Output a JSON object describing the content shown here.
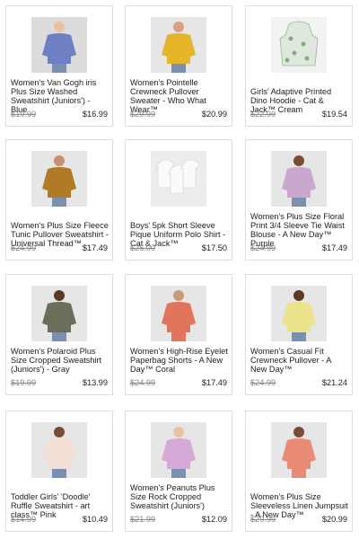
{
  "products": [
    {
      "title": "Women's Van Gogh iris Plus Size Washed Sweatshirt (Juniors') - Blue",
      "old_price": "$19.99",
      "price": "$16.99",
      "image": "van-gogh-sweatshirt",
      "color": "#6f7fc4",
      "skin": "#e8c3a3",
      "bg": "#dcdcdc"
    },
    {
      "title": "Women's Pointelle Crewneck Pullover Sweater - Who What Wear™",
      "old_price": "$29.99",
      "price": "$20.99",
      "image": "yellow-sweater",
      "color": "#e6b52a",
      "skin": "#d9a27e",
      "bg": "#e6e6e6"
    },
    {
      "title": "Girls' Adaptive Printed Dino Hoodie - Cat & Jack™ Cream",
      "old_price": "$22.99",
      "price": "$19.54",
      "image": "dino-hoodie",
      "color": "#dfe8dc",
      "skin": "#ffffff",
      "bg": "#f3f3f3"
    },
    {
      "title": "Women's Plus Size Fleece Tunic Pullover Sweatshirt - Universal Thread™",
      "old_price": "$24.99",
      "price": "$17.49",
      "image": "brown-sweatshirt",
      "color": "#b07a27",
      "skin": "#c99070",
      "bg": "#e6e6e6"
    },
    {
      "title": "Boys' 5pk Short Sleeve Pique Uniform Polo Shirt - Cat & Jack™",
      "old_price": "$25.00",
      "price": "$17.50",
      "image": "white-polos",
      "color": "#f7f7f7",
      "skin": "#ffffff",
      "bg": "#ededed"
    },
    {
      "title": "Women's Plus Size Floral Print 3/4 Sleeve Tie Waist Blouse - A New Day™ Purple",
      "old_price": "$24.99",
      "price": "$17.49",
      "image": "floral-blouse",
      "color": "#c9a7cf",
      "skin": "#7a4c34",
      "bg": "#e6e6e6"
    },
    {
      "title": "Women's Polaroid Plus Size Cropped Sweatshirt (Juniors') - Gray",
      "old_price": "$19.99",
      "price": "$13.99",
      "image": "camo-sweatshirt",
      "color": "#6b6f5a",
      "skin": "#5a3a27",
      "bg": "#e6e6e6"
    },
    {
      "title": "Women's High-Rise Eyelet Paperbag Shorts - A New Day™ Coral",
      "old_price": "$24.99",
      "price": "$17.49",
      "image": "coral-shorts",
      "color": "#e1755c",
      "skin": "#c79a7a",
      "bg": "#e6e6e6"
    },
    {
      "title": "Women's Casual Fit Crewneck Pullover - A New Day™",
      "old_price": "$24.99",
      "price": "$21.24",
      "image": "yellow-pullover",
      "color": "#ede38a",
      "skin": "#5a3a27",
      "bg": "#e6e6e6"
    },
    {
      "title": "Toddler Girls' 'Doodle' Ruffle Sweatshirt - art class™ Pink",
      "old_price": "$14.99",
      "price": "$10.49",
      "image": "doodle-sweatshirt",
      "color": "#f3dfd6",
      "skin": "#7a4c34",
      "bg": "#e6e6e6"
    },
    {
      "title": "Women's Peanuts Plus Size Rock Cropped Sweatshirt (Juniors')",
      "old_price": "$21.99",
      "price": "$12.09",
      "image": "tiedye-sweatshirt",
      "color": "#d7a9d6",
      "skin": "#e8c3a3",
      "bg": "#e6e6e6"
    },
    {
      "title": "Women's Plus Size Sleeveless Linen Jumpsuit - A New Day™",
      "old_price": "$29.99",
      "price": "$20.99",
      "image": "coral-jumpsuit",
      "color": "#e98b76",
      "skin": "#7a4c34",
      "bg": "#e6e6e6"
    }
  ]
}
